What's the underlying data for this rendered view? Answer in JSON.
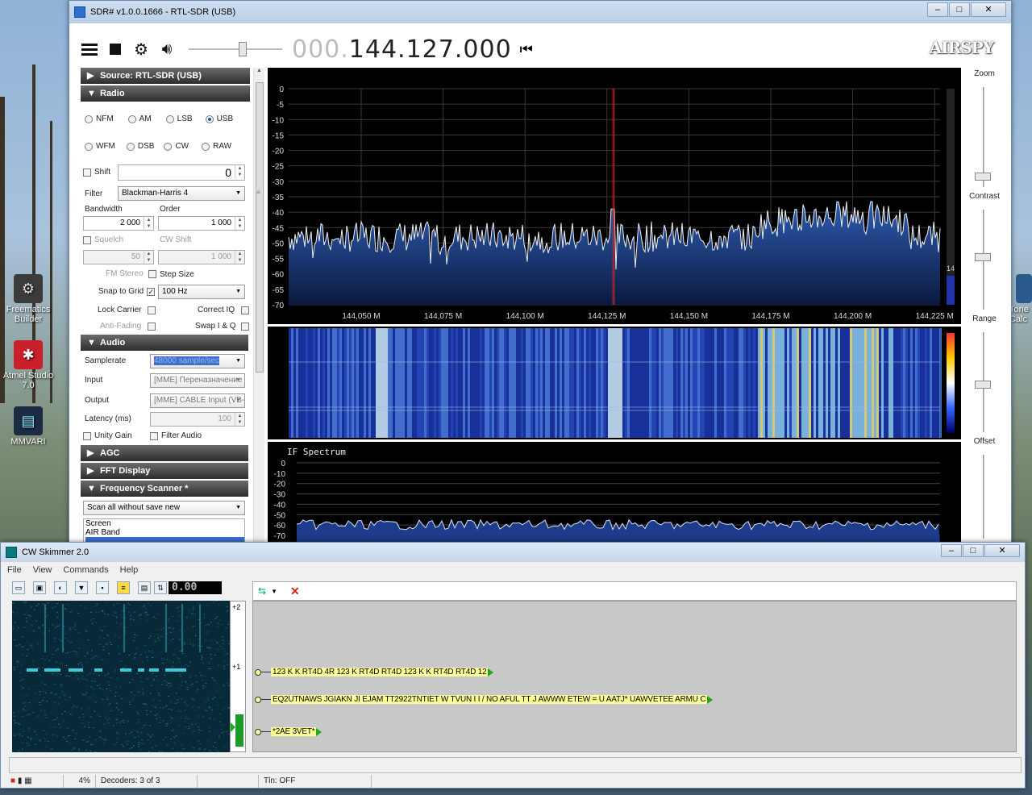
{
  "sdr": {
    "title": "SDR# v1.0.0.1666 - RTL-SDR (USB)",
    "frequency_dim": "000.",
    "frequency": "144.127.000",
    "brand": "AIRSPY",
    "sections": {
      "source": "Source: RTL-SDR (USB)",
      "radio": "Radio",
      "audio": "Audio",
      "agc": "AGC",
      "fft": "FFT Display",
      "freq_scanner": "Frequency Scanner *"
    },
    "modes_row1": [
      "NFM",
      "AM",
      "LSB",
      "USB"
    ],
    "modes_row2": [
      "WFM",
      "DSB",
      "CW",
      "RAW"
    ],
    "selected_mode": "USB",
    "shift_label": "Shift",
    "shift_value": "0",
    "filter_label": "Filter",
    "filter_value": "Blackman-Harris 4",
    "bandwidth_label": "Bandwidth",
    "bandwidth_value": "2 000",
    "order_label": "Order",
    "order_value": "1 000",
    "squelch_label": "Squelch",
    "squelch_value": "50",
    "cwshift_label": "CW Shift",
    "cwshift_value": "1 000",
    "fmstereo_label": "FM Stereo",
    "stepsize_label": "Step Size",
    "snap_label": "Snap to Grid",
    "step_value": "100 Hz",
    "lockcarrier_label": "Lock Carrier",
    "correctiq_label": "Correct IQ",
    "antifading_label": "Anti-Fading",
    "swapiq_label": "Swap I & Q",
    "samplerate_label": "Samplerate",
    "samplerate_value": "48000 sample/sec",
    "input_label": "Input",
    "input_value": "[MME] Переназначение",
    "output_label": "Output",
    "output_value": "[MME] CABLE Input (VB-",
    "latency_label": "Latency (ms)",
    "latency_value": "100",
    "unitygain_label": "Unity Gain",
    "filteraudio_label": "Filter Audio",
    "scan_value": "Scan all without save new",
    "scan_list": [
      "Screen",
      "AIR Band"
    ],
    "zoom_label": "Zoom",
    "contrast_label": "Contrast",
    "range_label": "Range",
    "offset_label": "Offset",
    "spectrum_y_ticks": [
      "0",
      "-5",
      "-10",
      "-15",
      "-20",
      "-25",
      "-30",
      "-35",
      "-40",
      "-45",
      "-50",
      "-55",
      "-60",
      "-65",
      "-70"
    ],
    "spectrum_x_ticks": [
      "144,050 M",
      "144,075 M",
      "144,100 M",
      "144,125 M",
      "144,150 M",
      "144,175 M",
      "144,200 M",
      "144,225 M"
    ],
    "spectrum_side_value": "14",
    "if_title": "IF Spectrum",
    "if_y_ticks": [
      "0",
      "-10",
      "-20",
      "-30",
      "-40",
      "-50",
      "-60",
      "-70"
    ]
  },
  "cw": {
    "title": "CW Skimmer 2.0",
    "menu": [
      "File",
      "View",
      "Commands",
      "Help"
    ],
    "lcd_value": "0.00",
    "scale_top": "+2",
    "scale_mid": "+1",
    "decodes": [
      "123 K K RT4D 4R 123 K RT4D RT4D 123 K K RT4D RT4D 12",
      "EQ2UTNAWS JGIAKN JI EJAM TT2922TNTIET W TVUN I I / NO AFUL TT J AWWW ETEW = U AATJ* UAWVETEE ARMU C",
      "*2AE 3VET*"
    ],
    "status_cpu": "4%",
    "status_decoders": "Decoders: 3 of 3",
    "status_tln": "Tln: OFF"
  },
  "desktop": {
    "icons": [
      {
        "label": "Freematics Builder"
      },
      {
        "label": "Atmel Studio 7.0"
      },
      {
        "label": "MMVARI"
      }
    ],
    "right_icon": "Tone Calc"
  },
  "colors": {
    "spectrum_fill": "#1b3e86",
    "accent_red": "#d42020",
    "decode_bg": "#ffff99"
  }
}
